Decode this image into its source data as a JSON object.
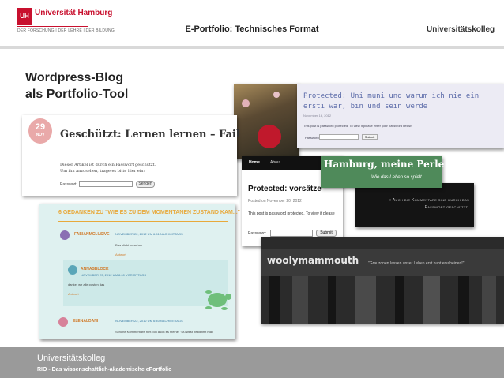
{
  "header": {
    "university": "Universität Hamburg",
    "logo_mark": "UH",
    "logo_sub": "DER FORSCHUNG | DER LEHRE | DER BILDUNG",
    "title": "E-Portfolio: Technisches Format",
    "brand": "Universitätskolleg"
  },
  "slide": {
    "title_line1": "Wordpress-Blog",
    "title_line2": "als Portfolio-Tool"
  },
  "footer": {
    "line1": "Universitätskolleg",
    "line2": "RIO - Das wissenschaftlich-akademische ePortfolio"
  },
  "shot_a": {
    "day": "29",
    "month": "NOV",
    "title": "Geschützt: Lernen lernen – Fail",
    "line1": "Dieser Artikel ist durch ein Passwort geschützt.",
    "line2": "Um ihn anzusehen, trage es bitte hier ein:",
    "password_label": "Passwort:",
    "button": "Senden"
  },
  "shot_c": {
    "title": "Protected: Uni muni und warum ich nie ein ersti war, bin und sein werde",
    "meta": "November 16, 2012",
    "text": "This post is password protected. To view it please enter your password below:",
    "password_label": "Password:",
    "button": "Submit"
  },
  "shot_d": {
    "nav_home": "Home",
    "nav_about": "About",
    "title": "Protected: vorsätze",
    "meta": "Posted on November 20, 2012",
    "text": "This post is password protected. To view it please",
    "password_label": "Password:",
    "button": "Submit"
  },
  "shot_e": {
    "title": "Hamburg, meine Perle",
    "subtitle": "Wie das Leben so spielt"
  },
  "shot_f": {
    "text": "» Auch die Kommentare sind durch das Passwort geschützt."
  },
  "shot_g": {
    "title": "woolymammouth",
    "quote": "\"Grauzonen lassen unser Leben erst bunt erscheinen!\""
  },
  "shot_h": {
    "title": "6 GEDANKEN ZU \"WIE ES ZU DEM MOMENTANEN ZUSTAND KAM...\"",
    "comments": [
      {
        "name": "FABIANMCLUSIVE",
        "date": "NOVEMBER 22, 2012 UM 6:51 NACHMITTAGS",
        "text": "Das klickt zu schon",
        "answer": "Antwort"
      },
      {
        "name": "ANNASBLOCK",
        "date": "NOVEMBER 23, 2012 UM 8:00 VORMITTAGS",
        "text": "danke! wir alle posten das",
        "answer": "Antwort"
      },
      {
        "name": "ELENALDANI",
        "date": "NOVEMBER 22, 2012 UM 6:40 NACHMITTAGS",
        "text": "Schöne Kommentare hier. Ich auch es meine! \"Du wirst bestimmt mal",
        "answer": ""
      }
    ]
  }
}
